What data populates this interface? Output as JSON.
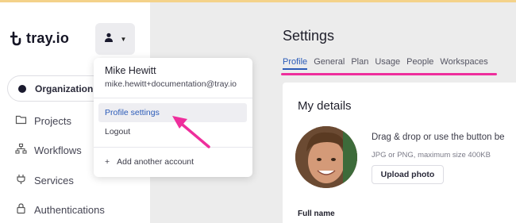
{
  "brand": {
    "name": "tray.io"
  },
  "sidebar": {
    "org_label": "Organization",
    "items": [
      {
        "label": "Projects",
        "icon": "folder-icon"
      },
      {
        "label": "Workflows",
        "icon": "workflow-icon"
      },
      {
        "label": "Services",
        "icon": "plug-icon"
      },
      {
        "label": "Authentications",
        "icon": "lock-icon"
      }
    ]
  },
  "main": {
    "title": "Settings",
    "tabs": [
      "Profile",
      "General",
      "Plan",
      "Usage",
      "People",
      "Workspaces"
    ],
    "active_tab": "Profile",
    "card": {
      "title": "My details",
      "drag_text": "Drag & drop or use the button be",
      "hint": "JPG or PNG, maximum size 400KB",
      "upload_label": "Upload photo",
      "full_name_label": "Full name"
    }
  },
  "account_menu": {
    "name": "Mike Hewitt",
    "email": "mike.hewitt+documentation@tray.io",
    "profile_settings": "Profile settings",
    "logout": "Logout",
    "add_account": "Add another account"
  },
  "colors": {
    "accent": "#2b5bb8",
    "annotation": "#ee2e9c"
  }
}
